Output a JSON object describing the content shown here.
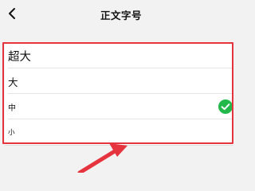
{
  "header": {
    "title": "正文字号"
  },
  "font_sizes": [
    {
      "label": "超大",
      "selected": false
    },
    {
      "label": "大",
      "selected": false
    },
    {
      "label": "中",
      "selected": true
    },
    {
      "label": "小",
      "selected": false
    }
  ],
  "colors": {
    "check": "#22b84a",
    "highlight": "#e5343e"
  },
  "icons": {
    "back": "chevron-left-icon",
    "check": "check-circle-icon",
    "annotation": "arrow-annotation"
  }
}
